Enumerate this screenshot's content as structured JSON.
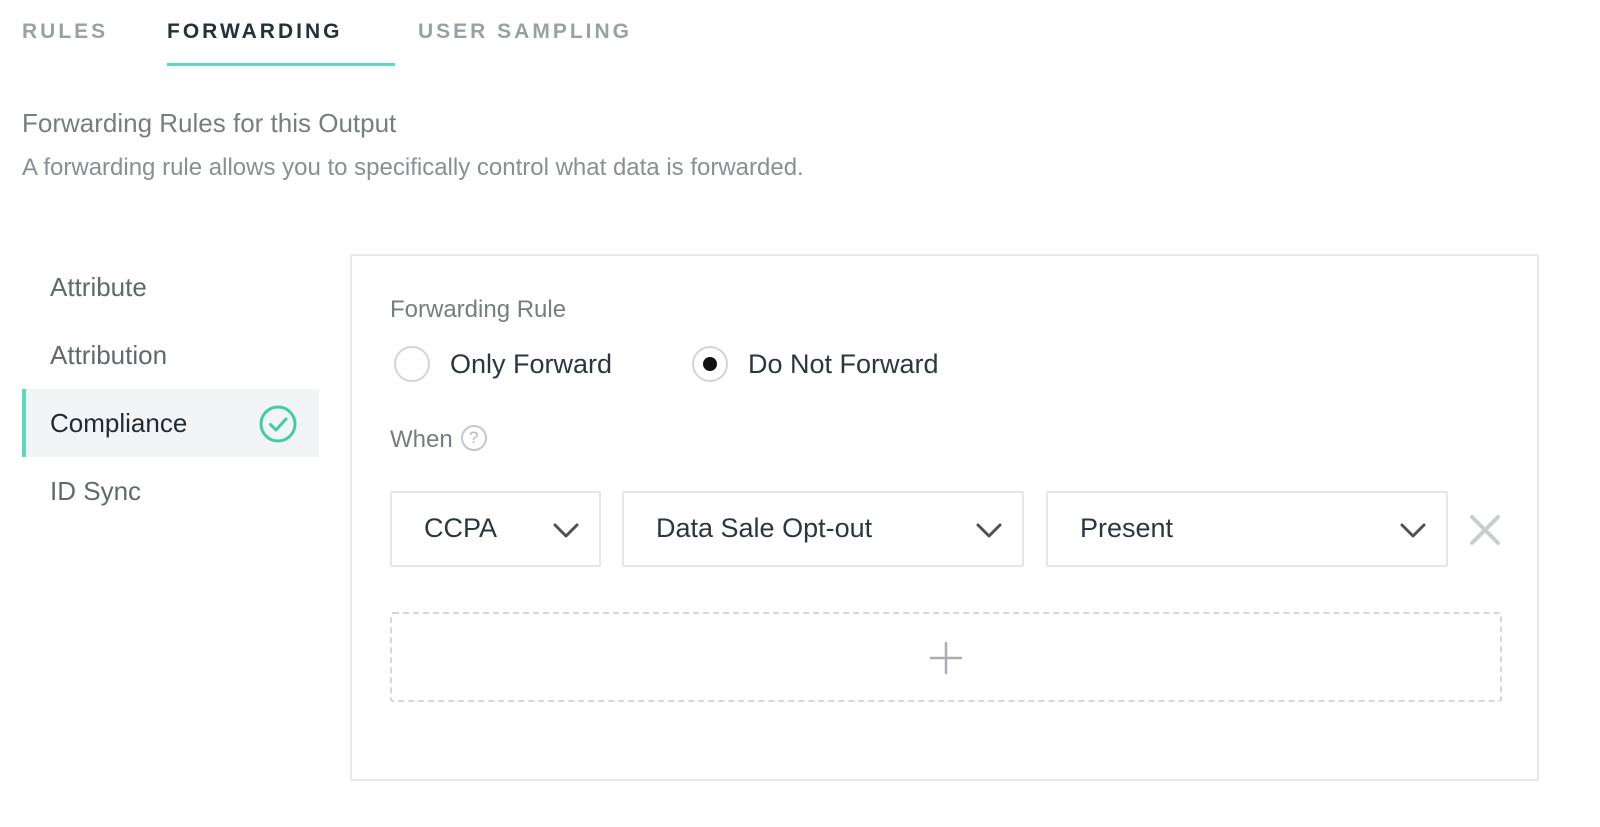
{
  "tabs": [
    {
      "label": "RULES",
      "active": false
    },
    {
      "label": "FORWARDING",
      "active": true
    },
    {
      "label": "USER SAMPLING",
      "active": false
    }
  ],
  "section": {
    "title": "Forwarding Rules for this Output",
    "description": "A forwarding rule allows you to specifically control what data is forwarded."
  },
  "sidenav": {
    "items": [
      {
        "label": "Attribute",
        "active": false
      },
      {
        "label": "Attribution",
        "active": false
      },
      {
        "label": "Compliance",
        "active": true,
        "icon": "check-circle-icon"
      },
      {
        "label": "ID Sync",
        "active": false
      }
    ]
  },
  "rule": {
    "label": "Forwarding Rule",
    "options": [
      {
        "label": "Only Forward",
        "checked": false
      },
      {
        "label": "Do Not Forward",
        "checked": true
      }
    ],
    "when_label": "When",
    "help_glyph": "?",
    "conditions": [
      {
        "value": "CCPA"
      },
      {
        "value": "Data Sale Opt-out"
      },
      {
        "value": "Present"
      }
    ]
  },
  "colors": {
    "accent": "#5fd6bf",
    "text_dark": "#24303a",
    "text_muted": "#9aa0a6",
    "border": "#e4e6e8"
  },
  "icons": {
    "remove": "close-icon",
    "add": "plus-icon",
    "dropdown": "chevron-down-icon",
    "help": "question-circle-icon"
  }
}
